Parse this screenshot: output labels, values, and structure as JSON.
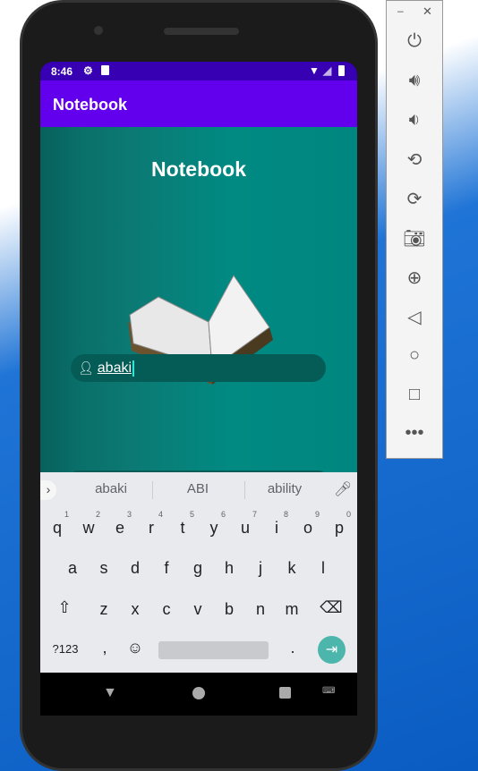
{
  "status": {
    "time": "8:46"
  },
  "appbar": {
    "title": "Notebook"
  },
  "content": {
    "heading": "Notebook",
    "username_value": "abaki"
  },
  "keyboard": {
    "suggestions": [
      "abaki",
      "ABI",
      "ability"
    ],
    "row1": [
      [
        "q",
        "1"
      ],
      [
        "w",
        "2"
      ],
      [
        "e",
        "3"
      ],
      [
        "r",
        "4"
      ],
      [
        "t",
        "5"
      ],
      [
        "y",
        "6"
      ],
      [
        "u",
        "7"
      ],
      [
        "i",
        "8"
      ],
      [
        "o",
        "9"
      ],
      [
        "p",
        "0"
      ]
    ],
    "row2": [
      "a",
      "s",
      "d",
      "f",
      "g",
      "h",
      "j",
      "k",
      "l"
    ],
    "row3": [
      "z",
      "x",
      "c",
      "v",
      "b",
      "n",
      "m"
    ],
    "sym": "?123",
    "comma": ",",
    "period": "."
  },
  "colors": {
    "status": "#3700b3",
    "appbar": "#6200ee",
    "teal": "#008680",
    "enter": "#4db6ac"
  }
}
